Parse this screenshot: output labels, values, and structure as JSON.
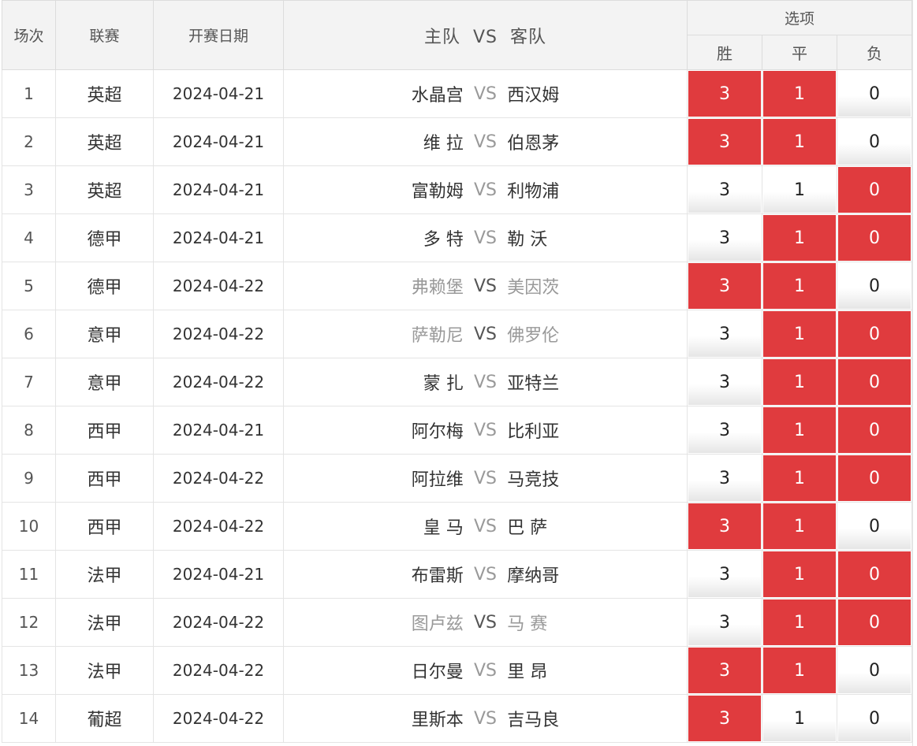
{
  "header": {
    "num": "场次",
    "league": "联赛",
    "date": "开赛日期",
    "home": "主队",
    "vs": "VS",
    "away": "客队",
    "options": "选项",
    "win": "胜",
    "draw": "平",
    "loss": "负"
  },
  "colors": {
    "selected": "#e03b3e",
    "header_bg": "#f3f3f3"
  },
  "rows": [
    {
      "num": "1",
      "league": "英超",
      "date": "2024-04-21",
      "home": "水晶宫",
      "vs": "VS",
      "away": "西汉姆",
      "win": "3",
      "draw": "1",
      "loss": "0",
      "sel": [
        true,
        true,
        false
      ],
      "dim": [
        false,
        false
      ]
    },
    {
      "num": "2",
      "league": "英超",
      "date": "2024-04-21",
      "home": "维 拉",
      "vs": "VS",
      "away": "伯恩茅",
      "win": "3",
      "draw": "1",
      "loss": "0",
      "sel": [
        true,
        true,
        false
      ],
      "dim": [
        false,
        false
      ]
    },
    {
      "num": "3",
      "league": "英超",
      "date": "2024-04-21",
      "home": "富勒姆",
      "vs": "VS",
      "away": "利物浦",
      "win": "3",
      "draw": "1",
      "loss": "0",
      "sel": [
        false,
        false,
        true
      ],
      "dim": [
        false,
        false
      ]
    },
    {
      "num": "4",
      "league": "德甲",
      "date": "2024-04-21",
      "home": "多 特",
      "vs": "VS",
      "away": "勒 沃",
      "win": "3",
      "draw": "1",
      "loss": "0",
      "sel": [
        false,
        true,
        true
      ],
      "dim": [
        false,
        false
      ]
    },
    {
      "num": "5",
      "league": "德甲",
      "date": "2024-04-22",
      "home": "弗赖堡",
      "vs": "VS",
      "away": "美因茨",
      "win": "3",
      "draw": "1",
      "loss": "0",
      "sel": [
        true,
        true,
        false
      ],
      "dim": [
        true,
        true
      ]
    },
    {
      "num": "6",
      "league": "意甲",
      "date": "2024-04-22",
      "home": "萨勒尼",
      "vs": "VS",
      "away": "佛罗伦",
      "win": "3",
      "draw": "1",
      "loss": "0",
      "sel": [
        false,
        true,
        true
      ],
      "dim": [
        true,
        true
      ]
    },
    {
      "num": "7",
      "league": "意甲",
      "date": "2024-04-22",
      "home": "蒙 扎",
      "vs": "VS",
      "away": "亚特兰",
      "win": "3",
      "draw": "1",
      "loss": "0",
      "sel": [
        false,
        true,
        true
      ],
      "dim": [
        false,
        false
      ]
    },
    {
      "num": "8",
      "league": "西甲",
      "date": "2024-04-21",
      "home": "阿尔梅",
      "vs": "VS",
      "away": "比利亚",
      "win": "3",
      "draw": "1",
      "loss": "0",
      "sel": [
        false,
        true,
        true
      ],
      "dim": [
        false,
        false
      ]
    },
    {
      "num": "9",
      "league": "西甲",
      "date": "2024-04-22",
      "home": "阿拉维",
      "vs": "VS",
      "away": "马竞技",
      "win": "3",
      "draw": "1",
      "loss": "0",
      "sel": [
        false,
        true,
        true
      ],
      "dim": [
        false,
        false
      ]
    },
    {
      "num": "10",
      "league": "西甲",
      "date": "2024-04-22",
      "home": "皇 马",
      "vs": "VS",
      "away": "巴 萨",
      "win": "3",
      "draw": "1",
      "loss": "0",
      "sel": [
        true,
        true,
        false
      ],
      "dim": [
        false,
        false
      ]
    },
    {
      "num": "11",
      "league": "法甲",
      "date": "2024-04-21",
      "home": "布雷斯",
      "vs": "VS",
      "away": "摩纳哥",
      "win": "3",
      "draw": "1",
      "loss": "0",
      "sel": [
        false,
        true,
        true
      ],
      "dim": [
        false,
        false
      ]
    },
    {
      "num": "12",
      "league": "法甲",
      "date": "2024-04-22",
      "home": "图卢兹",
      "vs": "VS",
      "away": "马 赛",
      "win": "3",
      "draw": "1",
      "loss": "0",
      "sel": [
        false,
        true,
        true
      ],
      "dim": [
        true,
        true
      ]
    },
    {
      "num": "13",
      "league": "法甲",
      "date": "2024-04-22",
      "home": "日尔曼",
      "vs": "VS",
      "away": "里 昂",
      "win": "3",
      "draw": "1",
      "loss": "0",
      "sel": [
        true,
        true,
        false
      ],
      "dim": [
        false,
        false
      ]
    },
    {
      "num": "14",
      "league": "葡超",
      "date": "2024-04-22",
      "home": "里斯本",
      "vs": "VS",
      "away": "吉马良",
      "win": "3",
      "draw": "1",
      "loss": "0",
      "sel": [
        true,
        false,
        false
      ],
      "dim": [
        false,
        false
      ]
    }
  ]
}
